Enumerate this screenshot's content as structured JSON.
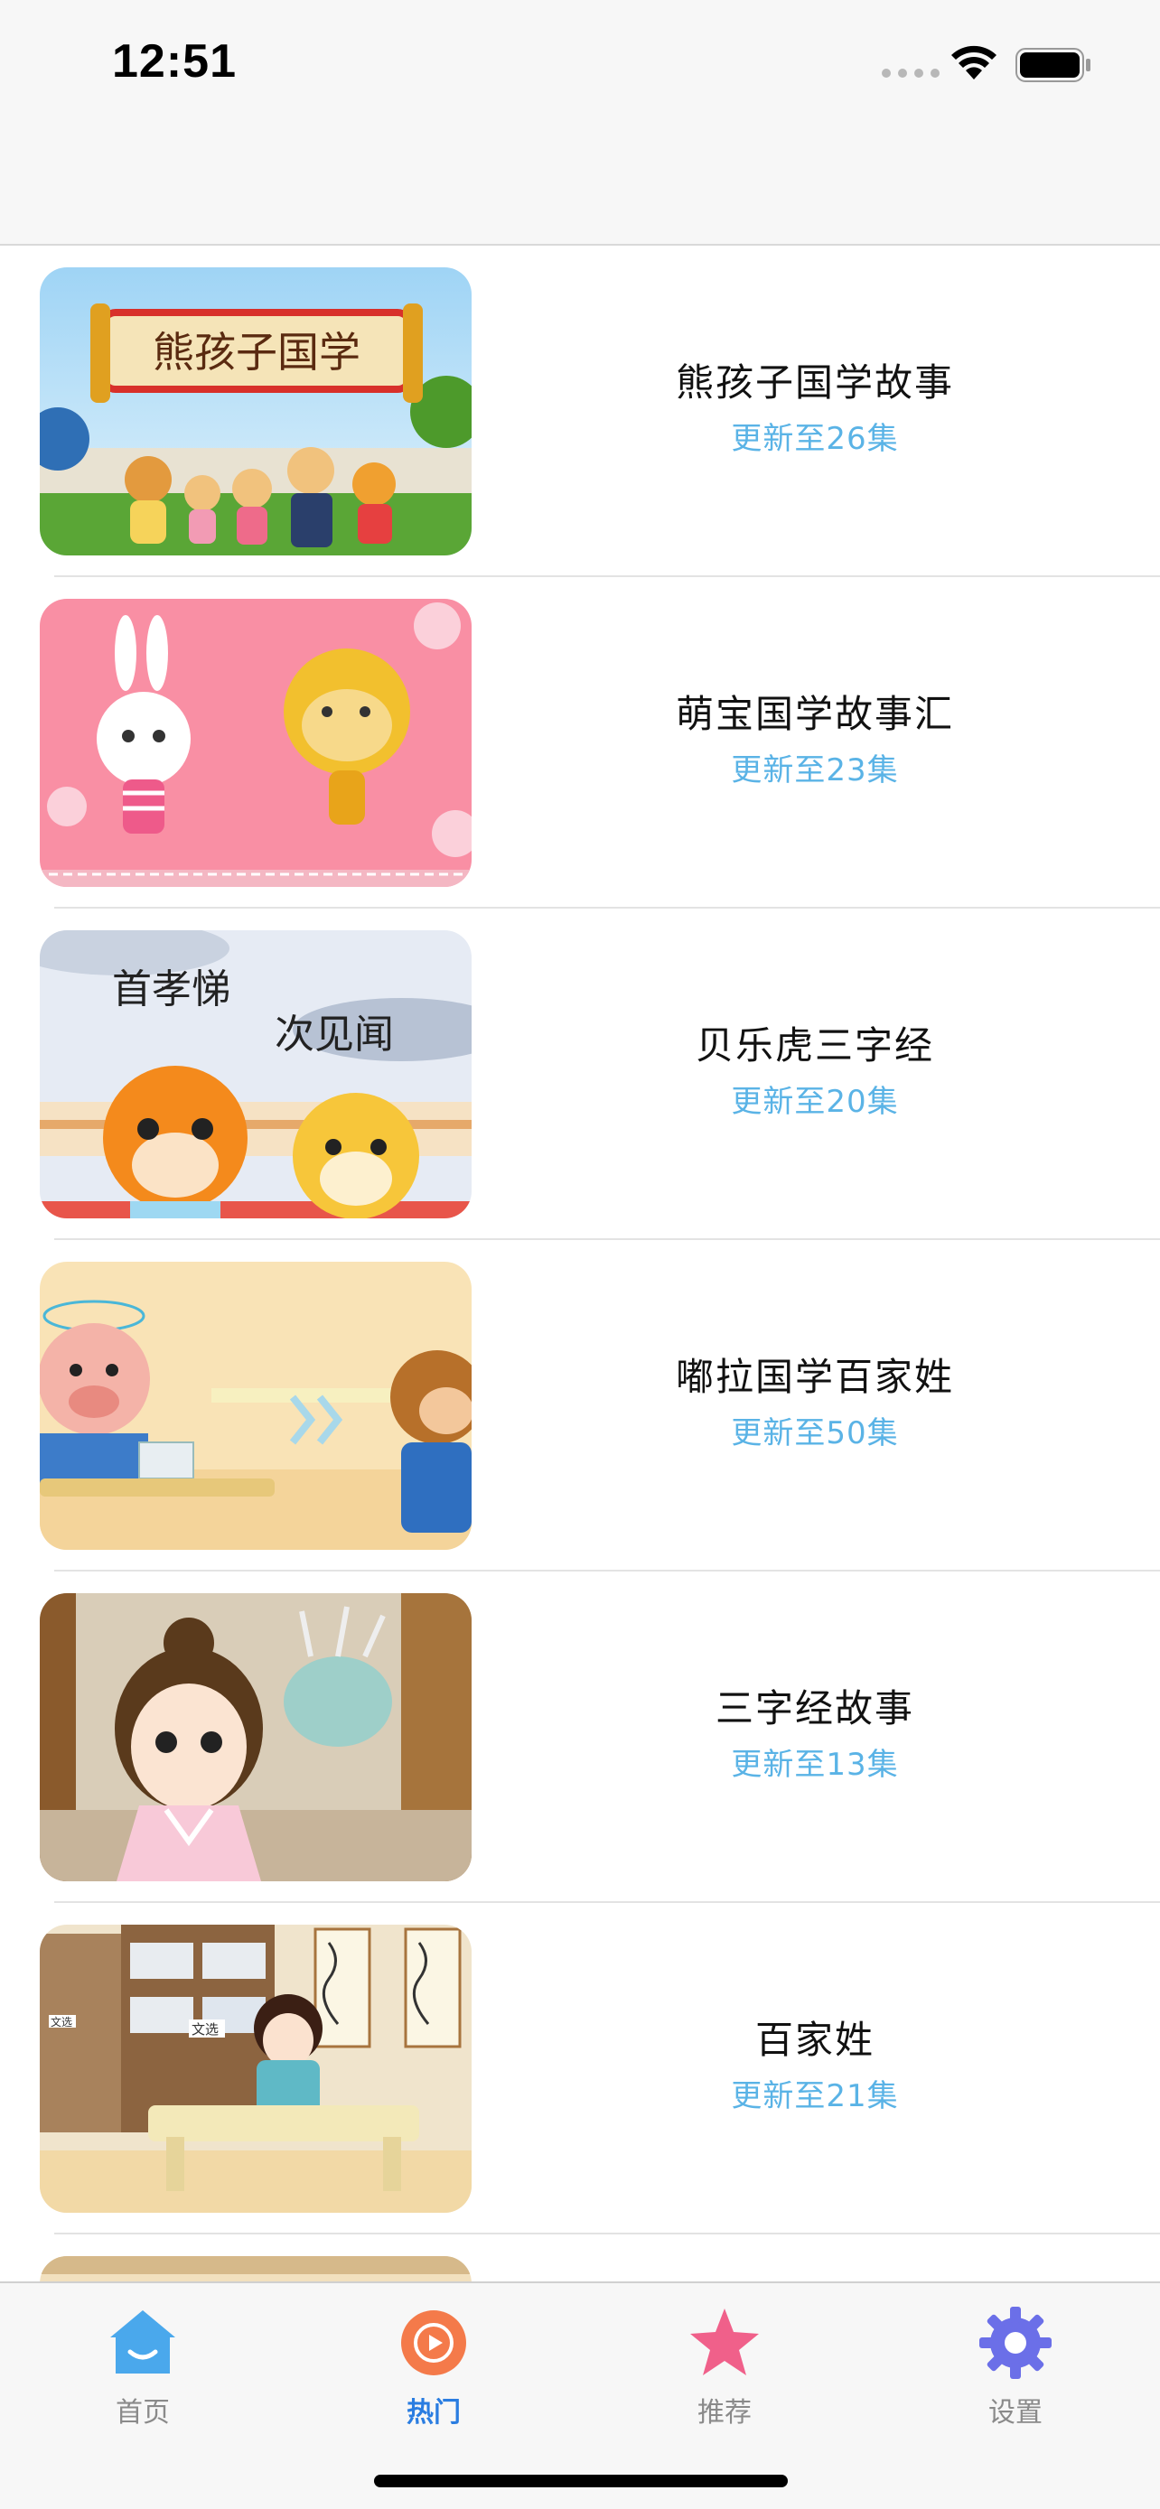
{
  "status_bar": {
    "time": "12:51"
  },
  "list": {
    "items": [
      {
        "title": "熊孩子国学故事",
        "subtitle": "更新至26集"
      },
      {
        "title": "萌宝国学故事汇",
        "subtitle": "更新至23集"
      },
      {
        "title": "贝乐虎三字经",
        "subtitle": "更新至20集"
      },
      {
        "title": "嘟拉国学百家姓",
        "subtitle": "更新至50集"
      },
      {
        "title": "三字经故事",
        "subtitle": "更新至13集"
      },
      {
        "title": "百家姓",
        "subtitle": "更新至21集"
      }
    ]
  },
  "thumbnails": {
    "t1_banner": "熊孩子国学",
    "t3_line1": "首孝悌",
    "t3_line2": "次见闻",
    "t6_tag1": "文选",
    "t6_tag2": "文选"
  },
  "tabbar": {
    "tabs": [
      {
        "label": "首页",
        "icon": "home-icon",
        "color": "#4aa8ec"
      },
      {
        "label": "热门",
        "icon": "play-icon",
        "color": "#f47a4a",
        "active": true
      },
      {
        "label": "推荐",
        "icon": "star-icon",
        "color": "#f0608a"
      },
      {
        "label": "设置",
        "icon": "gear-icon",
        "color": "#6b6fe8"
      }
    ]
  },
  "colors": {
    "accent": "#2a7de1",
    "subtitle": "#5ab3e6",
    "separator": "#e3e3e3"
  }
}
